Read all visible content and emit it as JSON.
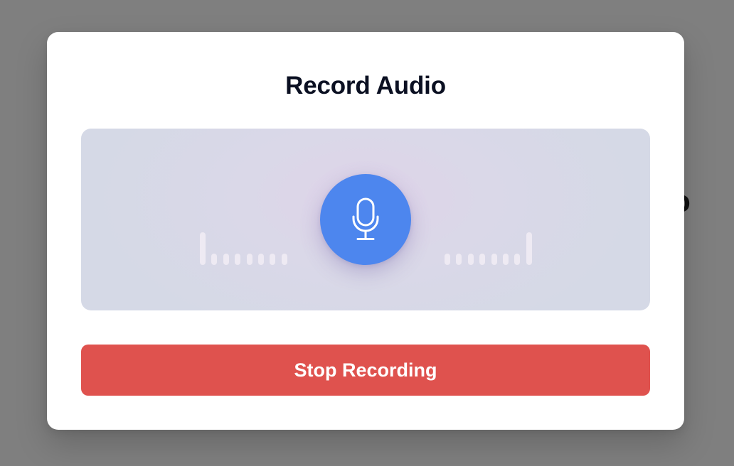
{
  "background": {
    "fragment_text": "o"
  },
  "modal": {
    "title": "Record Audio",
    "recorder": {
      "state": "recording",
      "mic_icon": "microphone-icon",
      "mic_color": "#4d86ee",
      "meter_color": "#eeeaf3",
      "left_meter_levels": [
        1.0,
        0.35,
        0.35,
        0.35,
        0.35,
        0.35,
        0.35,
        0.35
      ],
      "right_meter_levels": [
        0.35,
        0.35,
        0.35,
        0.35,
        0.35,
        0.35,
        0.35,
        1.0
      ]
    },
    "stop_button": {
      "label": "Stop Recording",
      "color": "#df524e"
    }
  }
}
